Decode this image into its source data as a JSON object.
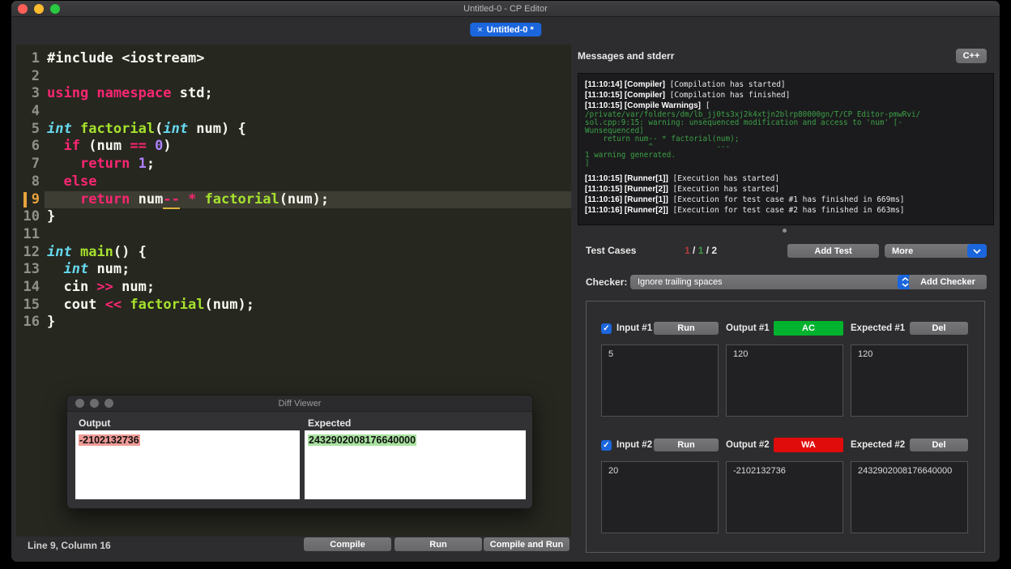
{
  "window": {
    "title": "Untitled-0 - CP Editor"
  },
  "tab": {
    "close_icon": "×",
    "label": "Untitled-0 *"
  },
  "editor": {
    "current_line": 9,
    "lines": [
      {
        "n": 1,
        "tokens": [
          {
            "t": "#include <iostream>",
            "c": "w"
          }
        ]
      },
      {
        "n": 2,
        "tokens": []
      },
      {
        "n": 3,
        "tokens": [
          {
            "t": "using namespace",
            "c": "p"
          },
          {
            "t": " std;",
            "c": "w"
          }
        ]
      },
      {
        "n": 4,
        "tokens": []
      },
      {
        "n": 5,
        "tokens": [
          {
            "t": "int",
            "c": "t"
          },
          {
            "t": " ",
            "c": "w"
          },
          {
            "t": "factorial",
            "c": "g"
          },
          {
            "t": "(",
            "c": "w"
          },
          {
            "t": "int",
            "c": "t"
          },
          {
            "t": " num) {",
            "c": "w"
          }
        ]
      },
      {
        "n": 6,
        "tokens": [
          {
            "t": "  ",
            "c": "w"
          },
          {
            "t": "if",
            "c": "p"
          },
          {
            "t": " (num ",
            "c": "w"
          },
          {
            "t": "==",
            "c": "p"
          },
          {
            "t": " ",
            "c": "w"
          },
          {
            "t": "0",
            "c": "n"
          },
          {
            "t": ")",
            "c": "w"
          }
        ]
      },
      {
        "n": 7,
        "tokens": [
          {
            "t": "    ",
            "c": "w"
          },
          {
            "t": "return",
            "c": "p"
          },
          {
            "t": " ",
            "c": "w"
          },
          {
            "t": "1",
            "c": "n"
          },
          {
            "t": ";",
            "c": "w"
          }
        ]
      },
      {
        "n": 8,
        "tokens": [
          {
            "t": "  ",
            "c": "w"
          },
          {
            "t": "else",
            "c": "p"
          }
        ]
      },
      {
        "n": 9,
        "tokens": [
          {
            "t": "    ",
            "c": "w"
          },
          {
            "t": "return",
            "c": "p"
          },
          {
            "t": " num",
            "c": "w"
          },
          {
            "t": "--",
            "c": "u"
          },
          {
            "t": " ",
            "c": "w"
          },
          {
            "t": "*",
            "c": "p"
          },
          {
            "t": " ",
            "c": "w"
          },
          {
            "t": "factorial",
            "c": "g"
          },
          {
            "t": "(num);",
            "c": "w"
          }
        ]
      },
      {
        "n": 10,
        "tokens": [
          {
            "t": "}",
            "c": "w"
          }
        ]
      },
      {
        "n": 11,
        "tokens": []
      },
      {
        "n": 12,
        "tokens": [
          {
            "t": "int",
            "c": "t"
          },
          {
            "t": " ",
            "c": "w"
          },
          {
            "t": "main",
            "c": "g"
          },
          {
            "t": "() {",
            "c": "w"
          }
        ]
      },
      {
        "n": 13,
        "tokens": [
          {
            "t": "  ",
            "c": "w"
          },
          {
            "t": "int",
            "c": "t"
          },
          {
            "t": " num;",
            "c": "w"
          }
        ]
      },
      {
        "n": 14,
        "tokens": [
          {
            "t": "  cin ",
            "c": "w"
          },
          {
            "t": ">>",
            "c": "p"
          },
          {
            "t": " num;",
            "c": "w"
          }
        ]
      },
      {
        "n": 15,
        "tokens": [
          {
            "t": "  cout ",
            "c": "w"
          },
          {
            "t": "<<",
            "c": "p"
          },
          {
            "t": " ",
            "c": "w"
          },
          {
            "t": "factorial",
            "c": "g"
          },
          {
            "t": "(num);",
            "c": "w"
          }
        ]
      },
      {
        "n": 16,
        "tokens": [
          {
            "t": "}",
            "c": "w"
          }
        ]
      }
    ]
  },
  "messages": {
    "title": "Messages and stderr",
    "language_button": "C++",
    "console": [
      {
        "prefix": "[11:10:14] [Compiler]",
        "text": " [Compilation has started]",
        "cls": "n"
      },
      {
        "prefix": "[11:10:15] [Compiler]",
        "text": " [Compilation has finished]",
        "cls": "n"
      },
      {
        "prefix": "[11:10:15] [Compile Warnings]",
        "text": " [",
        "cls": "n"
      },
      {
        "text": "/private/var/folders/dm/lb_jj0ts3xj2k4xtjn2blrp80000gn/T/CP Editor-pmwRvi/",
        "cls": "g"
      },
      {
        "text": "sol.cpp:9:15: warning: unsequenced modification and access to 'num' [-",
        "cls": "g"
      },
      {
        "text": "Wunsequenced]",
        "cls": "g"
      },
      {
        "text": "    return num-- * factorial(num);",
        "cls": "g"
      },
      {
        "text": "              ^              ---",
        "cls": "g"
      },
      {
        "text": "1 warning generated.",
        "cls": "g"
      },
      {
        "text": "]",
        "cls": "g"
      },
      {
        "prefix": "[11:10:15] [Runner[1]]",
        "text": " [Execution has started]",
        "cls": "n",
        "gap": true
      },
      {
        "prefix": "[11:10:15] [Runner[2]]",
        "text": " [Execution has started]",
        "cls": "n"
      },
      {
        "prefix": "[11:10:16] [Runner[1]]",
        "text": " [Execution for test case #1 has finished in 669ms]",
        "cls": "n"
      },
      {
        "prefix": "[11:10:16] [Runner[2]]",
        "text": " [Execution for test case #2 has finished in 663ms]",
        "cls": "n"
      }
    ]
  },
  "test_panel": {
    "heading": "Test Cases",
    "summary": {
      "failed": "1",
      "sep1": " / ",
      "passed": "1",
      "sep2": " / ",
      "total": "2"
    },
    "add_test_label": "Add Test",
    "more_label": "More",
    "checker_label": "Checker:",
    "checker_value": "Ignore trailing spaces",
    "add_checker_label": "Add Checker",
    "checkbox_check_icon": "✓",
    "cases": [
      {
        "checked": true,
        "input_label": "Input #1",
        "run_label": "Run",
        "output_label": "Output #1",
        "verdict": "AC",
        "verdict_color": "#00b22d",
        "expected_label": "Expected #1",
        "del_label": "Del",
        "input": "5",
        "output": "120",
        "expected": "120"
      },
      {
        "checked": true,
        "input_label": "Input #2",
        "run_label": "Run",
        "output_label": "Output #2",
        "verdict": "WA",
        "verdict_color": "#e00b0b",
        "expected_label": "Expected #2",
        "del_label": "Del",
        "input": "20",
        "output": "-2102132736",
        "expected": "2432902008176640000"
      }
    ]
  },
  "diff_viewer": {
    "title": "Diff Viewer",
    "output_label": "Output",
    "expected_label": "Expected",
    "output_value": "-2102132736",
    "expected_value": "2432902008176640000",
    "output_highlight": "#ef9a96",
    "expected_highlight": "#a9e2a0"
  },
  "status_bar": {
    "position": "Line 9, Column 16",
    "compile_label": "Compile",
    "run_label": "Run",
    "compile_and_run_label": "Compile and Run"
  },
  "colors": {
    "accent_blue": "#1b66dd",
    "ac_green": "#00b22d",
    "wa_red": "#e00b0b",
    "console_warning_green": "#3ca046",
    "current_line_marker": "#e8a33d",
    "traffic_red": "#ff5f57",
    "traffic_yellow": "#febc2e",
    "traffic_green": "#28c840"
  }
}
